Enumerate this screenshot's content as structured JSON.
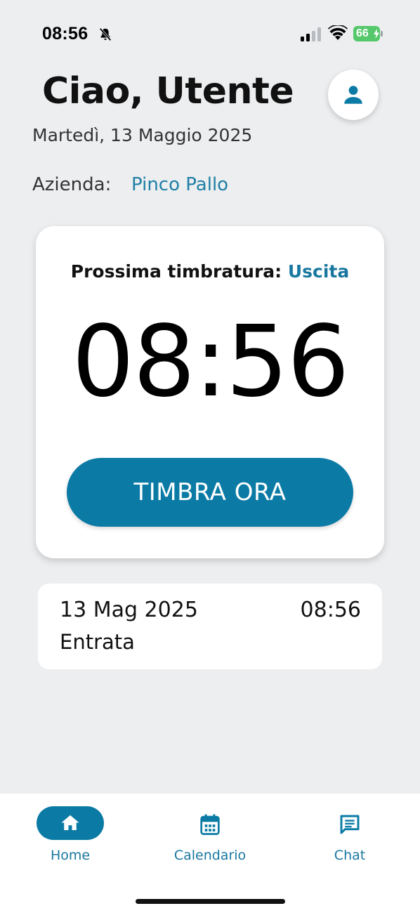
{
  "status_bar": {
    "time": "08:56",
    "battery": "66"
  },
  "header": {
    "greeting": "Ciao, Utente",
    "date": "Martedì, 13 Maggio 2025",
    "company_label": "Azienda:",
    "company_value": "Pinco Pallo"
  },
  "card": {
    "next_label": "Prossima timbratura:",
    "next_value": "Uscita",
    "clock": "08:56",
    "button_label": "TIMBRA ORA"
  },
  "records": [
    {
      "date": "13 Mag 2025",
      "time": "08:56",
      "type": "Entrata"
    }
  ],
  "nav": {
    "items": [
      {
        "label": "Home",
        "icon": "home-icon",
        "active": true
      },
      {
        "label": "Calendario",
        "icon": "calendar-icon",
        "active": false
      },
      {
        "label": "Chat",
        "icon": "chat-icon",
        "active": false
      }
    ]
  },
  "colors": {
    "accent": "#0b7ba5",
    "background": "#eceef0",
    "battery": "#54c86a"
  }
}
